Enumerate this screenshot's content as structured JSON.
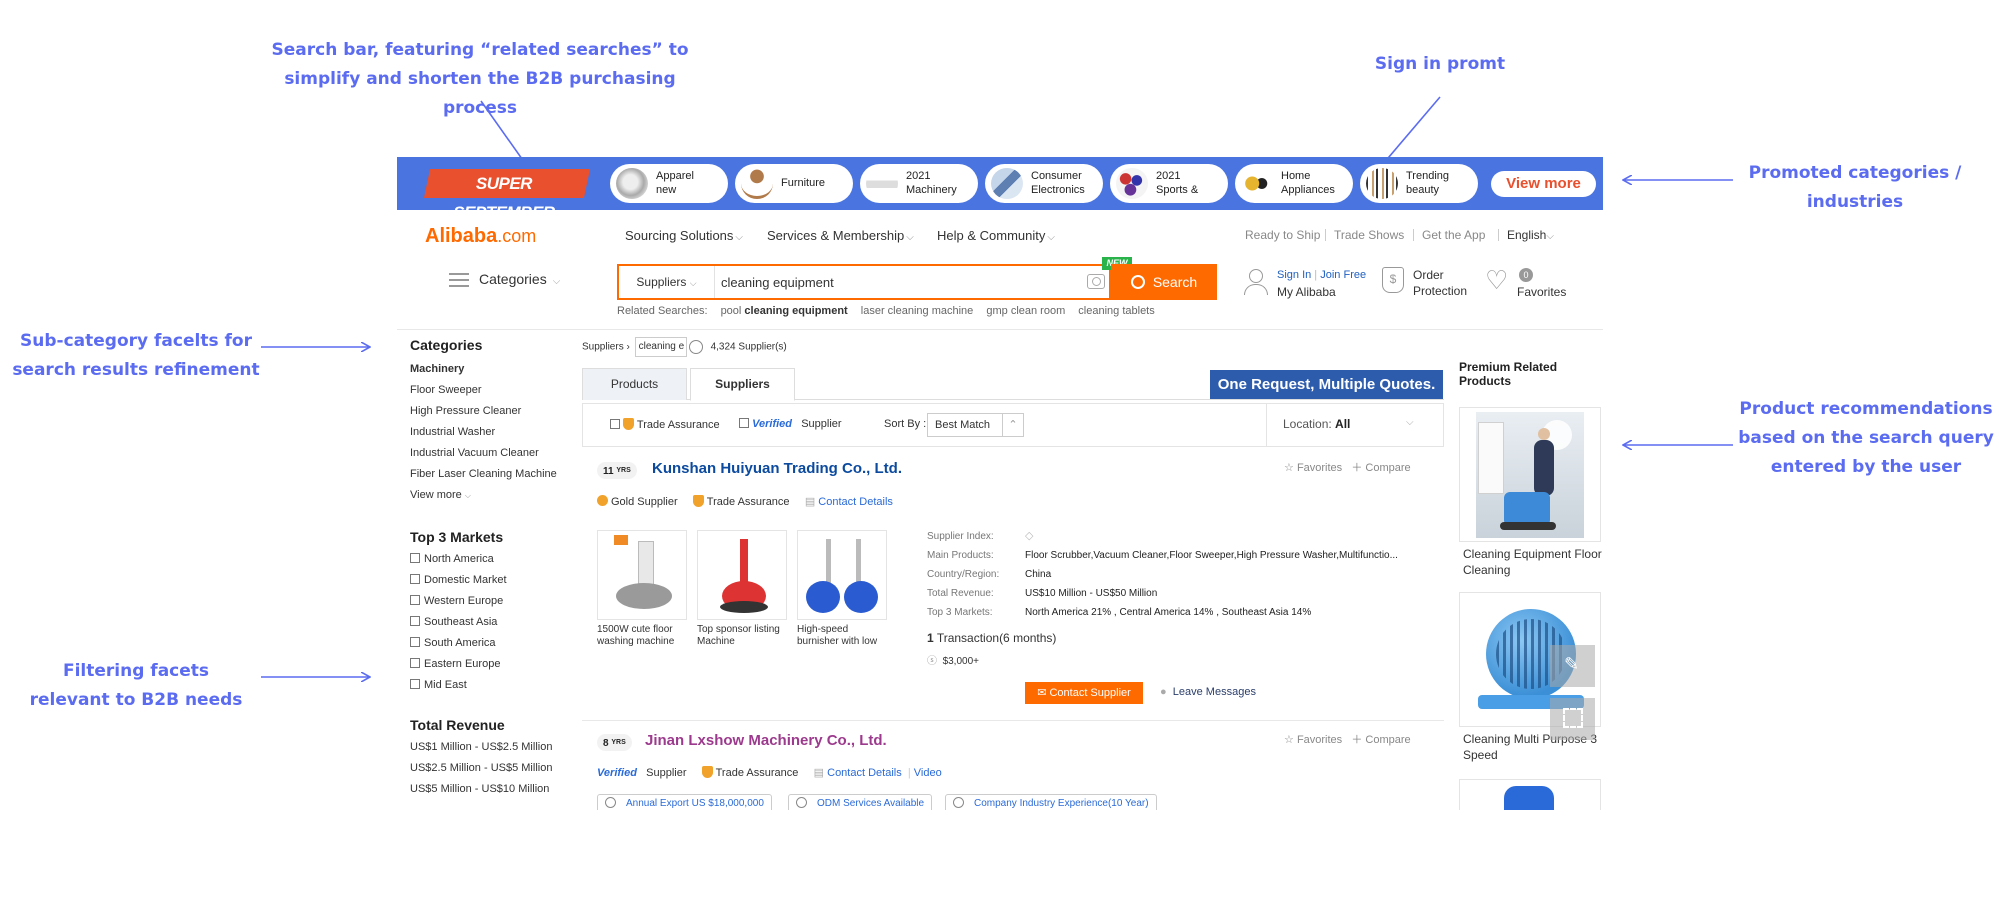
{
  "annotations": {
    "search_bar": "Search bar, featuring “related searches” to simplify and shorten the B2B purchasing process",
    "search_bar_line1": "Search bar, featuring “related searches” to",
    "search_bar_line2": "simplify and shorten the B2B purchasing process",
    "sign_in": "Sign in promt",
    "promoted_line1": "Promoted categories /",
    "promoted_line2": "industries",
    "subcat_line1": "Sub-category facelts for",
    "subcat_line2": "search results refinement",
    "reco_line1": "Product recommendations",
    "reco_line2": "based on the search query",
    "reco_line3": "entered by the user",
    "filter_line1": "Filtering facets",
    "filter_line2": "relevant to B2B needs"
  },
  "promo": {
    "banner": "SUPER SEPTEMBER",
    "categories": [
      {
        "label1": "Apparel",
        "label2": "new"
      },
      {
        "label1": "Furniture",
        "label2": ""
      },
      {
        "label1": "2021",
        "label2": "Machinery"
      },
      {
        "label1": "Consumer",
        "label2": "Electronics"
      },
      {
        "label1": "2021",
        "label2": "Sports &"
      },
      {
        "label1": "Home",
        "label2": "Appliances"
      },
      {
        "label1": "Trending",
        "label2": "beauty"
      }
    ],
    "view_more": "View more"
  },
  "header": {
    "logo_main": "Alibaba",
    "logo_suffix": ".com",
    "nav": [
      "Sourcing Solutions",
      "Services & Membership",
      "Help & Community"
    ],
    "nav_right": [
      "Ready to Ship",
      "Trade Shows",
      "Get the App",
      "English"
    ],
    "categories_label": "Categories"
  },
  "search": {
    "type": "Suppliers",
    "query": "cleaning equipment",
    "button": "Search",
    "new_badge": "NEW",
    "related_label": "Related Searches:",
    "related": [
      {
        "pre": "pool ",
        "bold": "cleaning equipment"
      },
      {
        "pre": "laser cleaning machine",
        "bold": ""
      },
      {
        "pre": "gmp clean room",
        "bold": ""
      },
      {
        "pre": "cleaning tablets",
        "bold": ""
      }
    ]
  },
  "user": {
    "sign_in": "Sign In",
    "join_free": "Join Free",
    "my_alibaba": "My Alibaba",
    "order_protection_1": "Order",
    "order_protection_2": "Protection",
    "favorites": "Favorites",
    "favorites_count": "0"
  },
  "sidebar": {
    "categories_title": "Categories",
    "categories": [
      "Machinery",
      "Floor Sweeper",
      "High Pressure Cleaner",
      "Industrial Washer",
      "Industrial Vacuum Cleaner",
      "Fiber Laser Cleaning Machine"
    ],
    "view_more": "View more",
    "markets_title": "Top 3 Markets",
    "markets": [
      "North America",
      "Domestic Market",
      "Western Europe",
      "Southeast Asia",
      "South America",
      "Eastern Europe",
      "Mid East"
    ],
    "revenue_title": "Total Revenue",
    "revenue": [
      "US$1 Million - US$2.5 Million",
      "US$2.5 Million - US$5 Million",
      "US$5 Million - US$10 Million"
    ]
  },
  "results": {
    "crumb_label": "Suppliers",
    "crumb_value": "cleaning e",
    "count": "4,324 Supplier(s)",
    "tab_products": "Products",
    "tab_suppliers": "Suppliers",
    "one_request": "One Request, Multiple Quotes.",
    "filter_trade": "Trade Assurance",
    "filter_verified": "Verified",
    "filter_supplier": "Supplier",
    "sort_by": "Sort By :",
    "sort_value": "Best Match",
    "location_label": "Location:",
    "location_value": "All"
  },
  "supplier1": {
    "years": "11",
    "yrs": "YRS",
    "name": "Kunshan Huiyuan Trading Co., Ltd.",
    "favorites": "Favorites",
    "compare": "Compare",
    "gold": "Gold Supplier",
    "trade": "Trade Assurance",
    "contact_details": "Contact Details",
    "products": [
      {
        "caption": "1500W cute floor washing machine"
      },
      {
        "caption": "Top sponsor listing Machine"
      },
      {
        "caption": "High-speed burnisher with low"
      }
    ],
    "info": [
      {
        "k": "Supplier Index:",
        "v": ""
      },
      {
        "k": "Main Products:",
        "v": "Floor Scrubber,Vacuum Cleaner,Floor Sweeper,High Pressure Washer,Multifunctio..."
      },
      {
        "k": "Country/Region:",
        "v": "China"
      },
      {
        "k": "Total Revenue:",
        "v": "US$10 Million - US$50 Million"
      },
      {
        "k": "Top 3 Markets:",
        "v": "North America 21% , Central America 14% , Southeast Asia 14%"
      }
    ],
    "transactions_count": "1",
    "transactions_label": "Transaction(6 months)",
    "amount": "$3,000+",
    "contact_btn": "Contact Supplier",
    "leave_msg": "Leave Messages"
  },
  "supplier2": {
    "years": "8",
    "yrs": "YRS",
    "name": "Jinan Lxshow Machinery Co., Ltd.",
    "favorites": "Favorites",
    "compare": "Compare",
    "verified": "Verified",
    "supplier": "Supplier",
    "trade": "Trade Assurance",
    "contact_details": "Contact Details",
    "video": "Video",
    "tags": [
      "Annual Export US $18,000,000",
      "ODM Services Available",
      "Company Industry Experience(10 Year)"
    ]
  },
  "premium": {
    "title": "Premium Related Products",
    "items": [
      {
        "caption": "Cleaning Equipment Floor Cleaning"
      },
      {
        "caption": "Cleaning Multi Purpose 3 Speed"
      }
    ]
  },
  "colors": {
    "annotation": "#5b6cf0",
    "promo_bg": "#4a74e0",
    "accent_orange": "#ff6a00",
    "link_blue": "#2060c0",
    "supplier1_name": "#0b4a9e",
    "supplier2_name": "#9c3a8d"
  }
}
